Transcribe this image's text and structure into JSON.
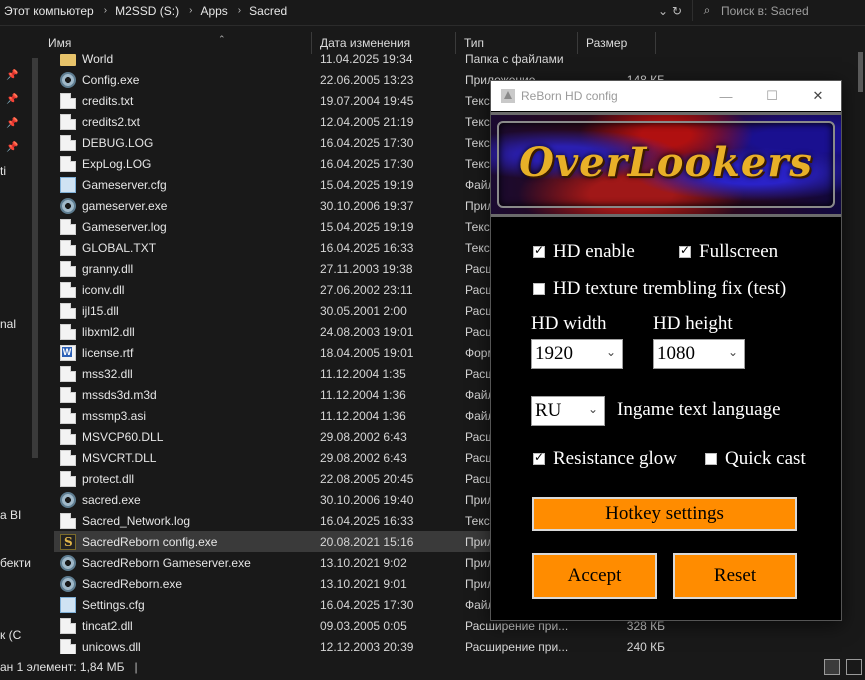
{
  "explorer": {
    "breadcrumb": [
      "Этот компьютер",
      "M2SSD (S:)",
      "Apps",
      "Sacred"
    ],
    "search_placeholder": "Поиск в: Sacred",
    "nav_fragments": [
      "ti",
      "nal",
      "a BI",
      "бекти",
      "к (С"
    ],
    "columns": {
      "name": "Имя",
      "date": "Дата изменения",
      "type": "Тип",
      "size": "Размер"
    },
    "rows": [
      {
        "name": "World",
        "date": "11.04.2025 19:34",
        "type": "Папка с файлами",
        "size": "",
        "icon": "folder"
      },
      {
        "name": "Config.exe",
        "date": "22.06.2005 13:23",
        "type": "Приложение",
        "size": "148 КБ",
        "icon": "gear"
      },
      {
        "name": "credits.txt",
        "date": "19.07.2004 19:45",
        "type": "Текст",
        "size": "",
        "icon": "file"
      },
      {
        "name": "credits2.txt",
        "date": "12.04.2005 21:19",
        "type": "Текст",
        "size": "",
        "icon": "file"
      },
      {
        "name": "DEBUG.LOG",
        "date": "16.04.2025 17:30",
        "type": "Текст",
        "size": "",
        "icon": "file"
      },
      {
        "name": "ExpLog.LOG",
        "date": "16.04.2025 17:30",
        "type": "Текст",
        "size": "",
        "icon": "file"
      },
      {
        "name": "Gameserver.cfg",
        "date": "15.04.2025 19:19",
        "type": "Файл",
        "size": "",
        "icon": "cfg"
      },
      {
        "name": "gameserver.exe",
        "date": "30.10.2006 19:37",
        "type": "Прил",
        "size": "",
        "icon": "gear"
      },
      {
        "name": "Gameserver.log",
        "date": "15.04.2025 19:19",
        "type": "Текст",
        "size": "",
        "icon": "file"
      },
      {
        "name": "GLOBAL.TXT",
        "date": "16.04.2025 16:33",
        "type": "Текст",
        "size": "",
        "icon": "file"
      },
      {
        "name": "granny.dll",
        "date": "27.11.2003 19:38",
        "type": "Расши",
        "size": "",
        "icon": "file"
      },
      {
        "name": "iconv.dll",
        "date": "27.06.2002 23:11",
        "type": "Расши",
        "size": "",
        "icon": "file"
      },
      {
        "name": "ijl15.dll",
        "date": "30.05.2001 2:00",
        "type": "Расши",
        "size": "",
        "icon": "file"
      },
      {
        "name": "libxml2.dll",
        "date": "24.08.2003 19:01",
        "type": "Расши",
        "size": "",
        "icon": "file"
      },
      {
        "name": "license.rtf",
        "date": "18.04.2005 19:01",
        "type": "Форм",
        "size": "",
        "icon": "rtf"
      },
      {
        "name": "mss32.dll",
        "date": "11.12.2004 1:35",
        "type": "Расши",
        "size": "",
        "icon": "file"
      },
      {
        "name": "mssds3d.m3d",
        "date": "11.12.2004 1:36",
        "type": "Файл",
        "size": "",
        "icon": "file"
      },
      {
        "name": "mssmp3.asi",
        "date": "11.12.2004 1:36",
        "type": "Файл",
        "size": "",
        "icon": "file"
      },
      {
        "name": "MSVCP60.DLL",
        "date": "29.08.2002 6:43",
        "type": "Расши",
        "size": "",
        "icon": "file"
      },
      {
        "name": "MSVCRT.DLL",
        "date": "29.08.2002 6:43",
        "type": "Расши",
        "size": "",
        "icon": "file"
      },
      {
        "name": "protect.dll",
        "date": "22.08.2005 20:45",
        "type": "Расши",
        "size": "",
        "icon": "file"
      },
      {
        "name": "sacred.exe",
        "date": "30.10.2006 19:40",
        "type": "Прил",
        "size": "",
        "icon": "gear"
      },
      {
        "name": "Sacred_Network.log",
        "date": "16.04.2025 16:33",
        "type": "Текст",
        "size": "",
        "icon": "file"
      },
      {
        "name": "SacredReborn config.exe",
        "date": "20.08.2021 15:16",
        "type": "Прил",
        "size": "",
        "icon": "sacred"
      },
      {
        "name": "SacredReborn Gameserver.exe",
        "date": "13.10.2021 9:02",
        "type": "Прил",
        "size": "",
        "icon": "gear"
      },
      {
        "name": "SacredReborn.exe",
        "date": "13.10.2021 9:01",
        "type": "Прил",
        "size": "",
        "icon": "gear"
      },
      {
        "name": "Settings.cfg",
        "date": "16.04.2025 17:30",
        "type": "Файл",
        "size": "",
        "icon": "cfg"
      },
      {
        "name": "tincat2.dll",
        "date": "09.03.2005 0:05",
        "type": "Расширение при...",
        "size": "328 КБ",
        "icon": "file"
      },
      {
        "name": "unicows.dll",
        "date": "12.12.2003 20:39",
        "type": "Расширение при...",
        "size": "240 КБ",
        "icon": "file"
      }
    ],
    "status": "ан 1 элемент: 1,84 МБ"
  },
  "dialog": {
    "title": "ReBorn HD config",
    "logo_text": "OverLookers",
    "hd_enable": {
      "label": "HD enable",
      "checked": true
    },
    "fullscreen": {
      "label": "Fullscreen",
      "checked": true
    },
    "trembling_fix": {
      "label": "HD texture trembling fix (test)",
      "checked": false
    },
    "hd_width": {
      "label": "HD width",
      "value": "1920"
    },
    "hd_height": {
      "label": "HD height",
      "value": "1080"
    },
    "language": {
      "value": "RU",
      "label": "Ingame text language"
    },
    "resistance_glow": {
      "label": "Resistance glow",
      "checked": true
    },
    "quick_cast": {
      "label": "Quick cast",
      "checked": false
    },
    "hotkey_button": "Hotkey settings",
    "accept_button": "Accept",
    "reset_button": "Reset"
  },
  "colors": {
    "explorer_bg": "#191919",
    "selected_row": "#3a3a3a",
    "button_orange": "#ff8c00",
    "logo_gold": "#e8b028"
  }
}
